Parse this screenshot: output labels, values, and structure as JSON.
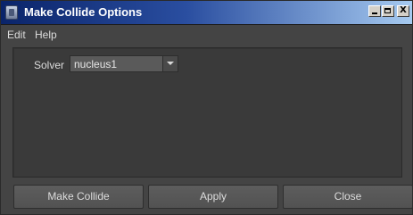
{
  "window": {
    "title": "Make Collide Options",
    "controls": {
      "minimize": "",
      "maximize": "",
      "close": "X"
    }
  },
  "menubar": {
    "items": [
      {
        "label": "Edit"
      },
      {
        "label": "Help"
      }
    ]
  },
  "options": {
    "solver": {
      "label": "Solver",
      "value": "nucleus1"
    }
  },
  "buttons": {
    "make_collide": "Make Collide",
    "apply": "Apply",
    "close": "Close"
  },
  "colors": {
    "panel_bg": "#444444",
    "frame_bg": "#3a3a3a",
    "button_bg": "#5a5a5a",
    "titlebar_start": "#0a246a",
    "titlebar_end": "#a6caf0",
    "text": "#dcdcdc"
  }
}
